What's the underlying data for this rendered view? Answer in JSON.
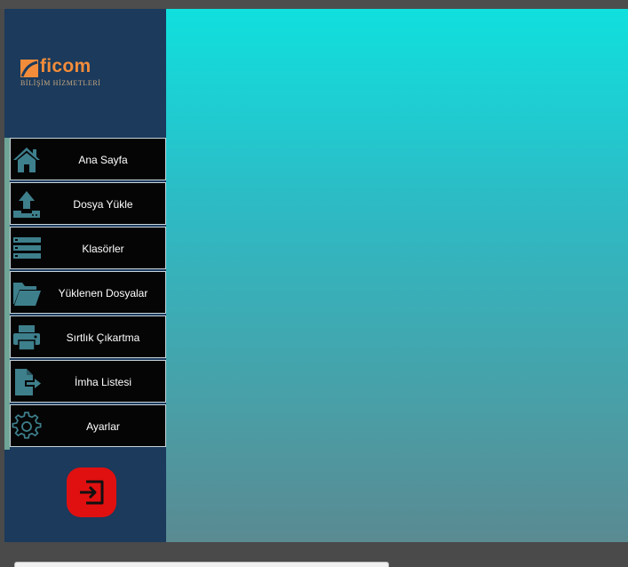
{
  "brand": {
    "name": "ficom",
    "subtitle": "BİLİŞİM HİZMETLERİ",
    "colors": {
      "accent": "#f28c3a",
      "sidebar": "#1b3a5c",
      "logout": "#e01010",
      "content_top": "#10e0de",
      "content_bottom": "#5a8a92"
    }
  },
  "sidebar": {
    "items": [
      {
        "label": "Ana Sayfa",
        "icon": "home-icon"
      },
      {
        "label": "Dosya Yükle",
        "icon": "upload-icon"
      },
      {
        "label": "Klasörler",
        "icon": "list-icon"
      },
      {
        "label": "Yüklenen Dosyalar",
        "icon": "folder-open-icon"
      },
      {
        "label": "Sırtlık Çıkartma",
        "icon": "printer-icon"
      },
      {
        "label": "İmha Listesi",
        "icon": "file-export-icon"
      },
      {
        "label": "Ayarlar",
        "icon": "gear-icon"
      }
    ],
    "logout_icon": "logout-icon"
  }
}
